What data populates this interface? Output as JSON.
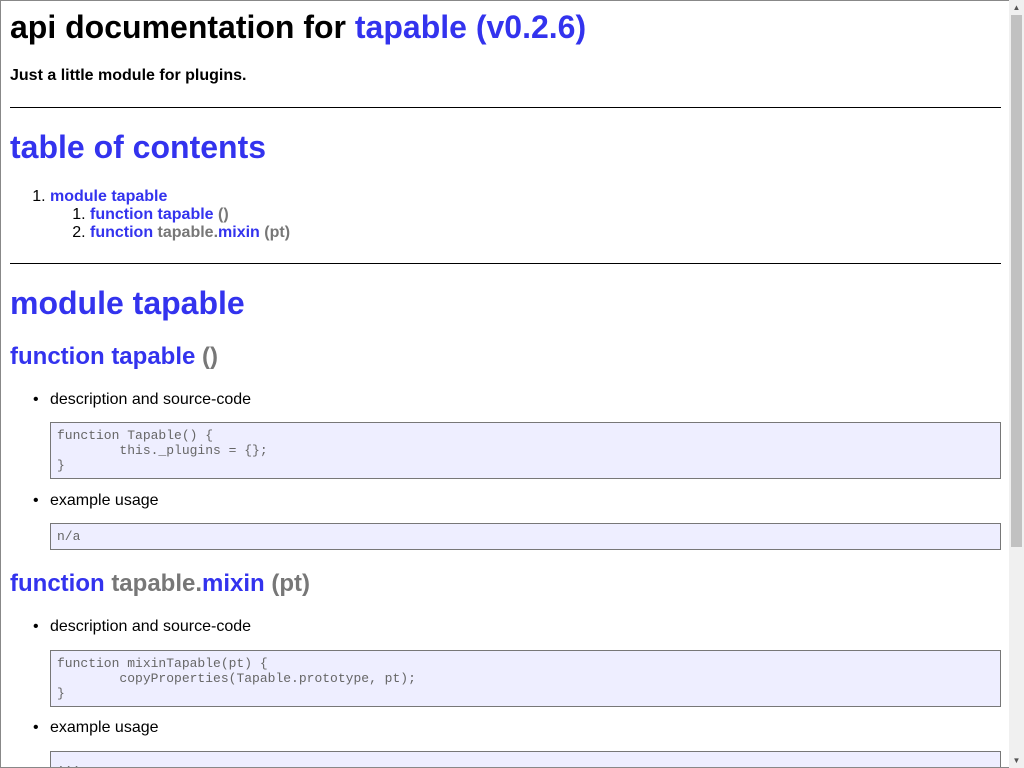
{
  "header": {
    "title_prefix": "api documentation for",
    "title_link": "tapable (v0.2.6)",
    "tagline": "Just a little module for plugins."
  },
  "toc": {
    "title": "table of contents",
    "module": "module tapable",
    "items": [
      {
        "keyword": "function",
        "prefix": "",
        "name": "tapable",
        "args": "()"
      },
      {
        "keyword": "function",
        "prefix": "tapable.",
        "name": "mixin",
        "args": "(pt)"
      }
    ]
  },
  "module": {
    "title": "module tapable"
  },
  "functions": [
    {
      "keyword": "function",
      "prefix": "",
      "name": "tapable",
      "args": "()",
      "desc_label": "description and source-code",
      "source": "function Tapable() {\n\tthis._plugins = {};\n}",
      "example_label": "example usage",
      "example": "n/a"
    },
    {
      "keyword": "function",
      "prefix": "tapable.",
      "name": "mixin",
      "args": "(pt)",
      "desc_label": "description and source-code",
      "source": "function mixinTapable(pt) {\n\tcopyProperties(Tapable.prototype, pt);\n}",
      "example_label": "example usage",
      "example": "..."
    }
  ],
  "icons": {
    "scroll_up": "arrow-up-icon",
    "scroll_down": "arrow-down-icon"
  }
}
